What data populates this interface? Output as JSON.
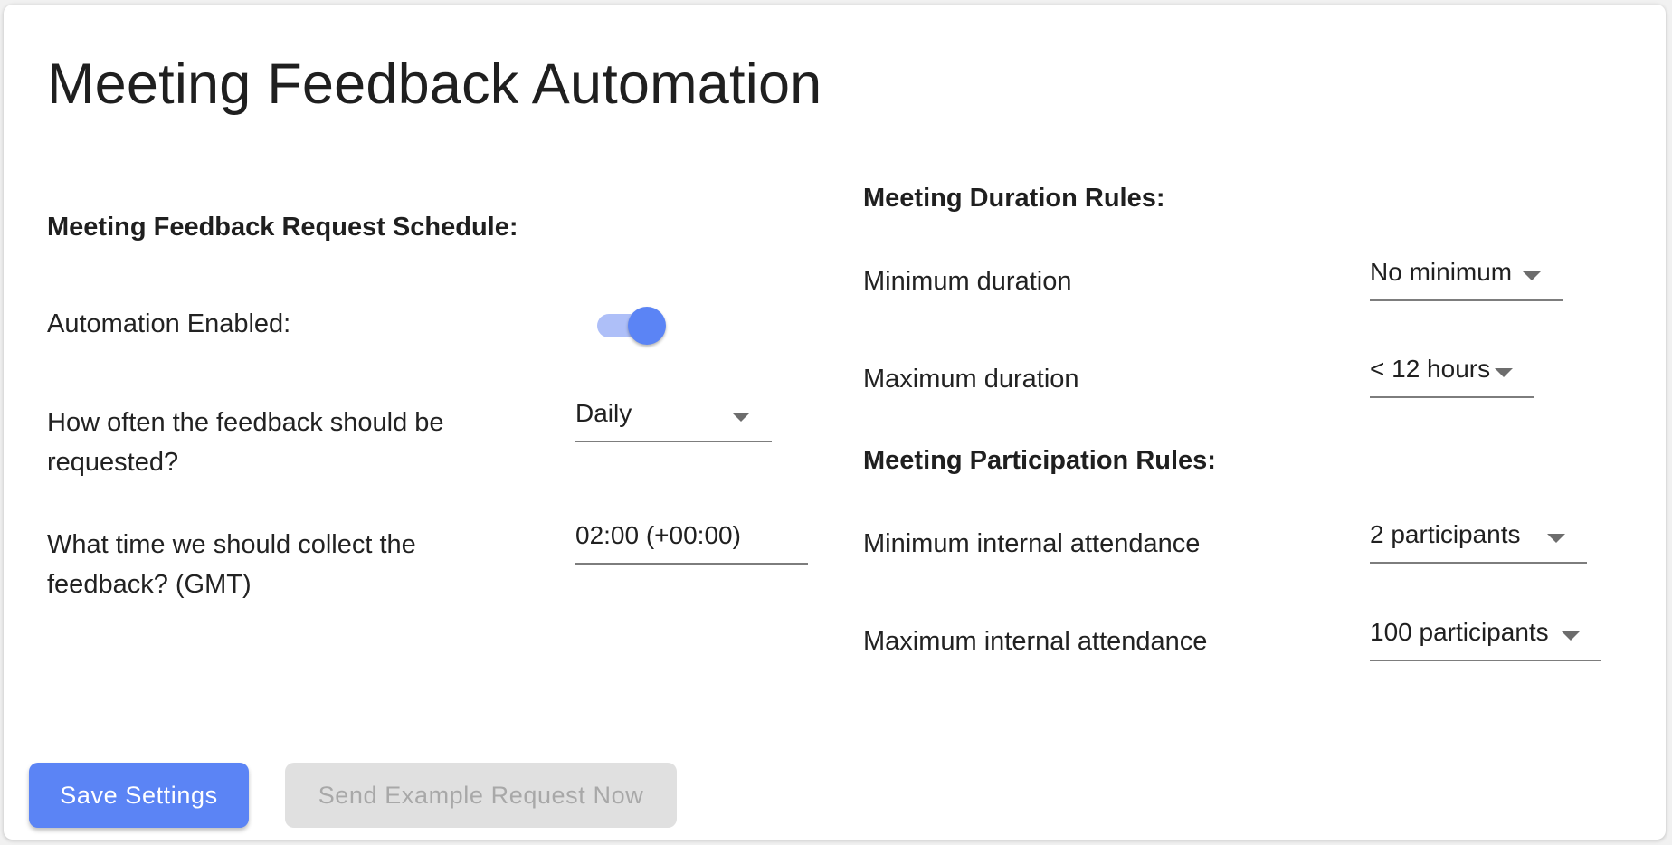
{
  "page": {
    "title": "Meeting Feedback Automation"
  },
  "schedule": {
    "heading": "Meeting Feedback Request Schedule:",
    "automation_label": "Automation Enabled:",
    "automation_enabled": true,
    "frequency_label_line1": "How often the feedback should be",
    "frequency_label_line2": "requested?",
    "frequency_value": "Daily",
    "time_label_line1": "What time we should collect the",
    "time_label_line2": "feedback? (GMT)",
    "time_value": "02:00 (+00:00)"
  },
  "duration_rules": {
    "heading": "Meeting Duration Rules:",
    "min_label": "Minimum duration",
    "min_value": "No minimum",
    "max_label": "Maximum duration",
    "max_value": "< 12 hours"
  },
  "participation_rules": {
    "heading": "Meeting Participation Rules:",
    "min_label": "Minimum internal attendance",
    "min_value": "2 participants",
    "max_label": "Maximum internal attendance",
    "max_value": "100 participants"
  },
  "actions": {
    "save_label": "Save Settings",
    "example_label": "Send Example Request Now",
    "example_disabled": true
  },
  "colors": {
    "accent": "#5b84f5",
    "toggle_track": "#aebff8",
    "disabled_bg": "#e0e0e0",
    "disabled_text": "#a8a8a8"
  }
}
